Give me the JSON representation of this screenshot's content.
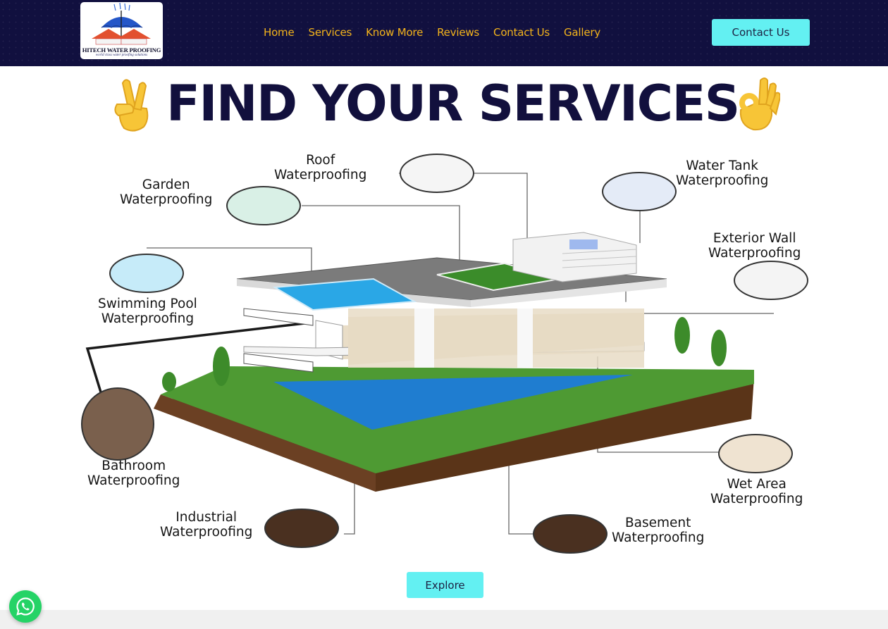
{
  "brand": {
    "name": "HITECH WATER PROOFING",
    "tagline": "world class water proofing solutions"
  },
  "nav": {
    "links": [
      "Home",
      "Services",
      "Know More",
      "Reviews",
      "Contact Us",
      "Gallery"
    ],
    "cta_label": "Contact Us"
  },
  "hero": {
    "headline": "FIND YOUR SERVICES",
    "emoji_left": "fingers-crossed-icon",
    "emoji_right": "ok-hand-icon"
  },
  "services_diagram": {
    "roof": [
      "Roof",
      "Waterproofing"
    ],
    "garden": [
      "Garden",
      "Waterproofing"
    ],
    "water_tank": [
      "Water Tank",
      "Waterproofing"
    ],
    "exterior_wall": [
      "Exterior Wall",
      "Waterproofing"
    ],
    "swimming_pool": [
      "Swimming Pool",
      "Waterproofing"
    ],
    "bathroom": [
      "Bathroom",
      "Waterproofing"
    ],
    "wet_area": [
      "Wet Area",
      "Waterproofing"
    ],
    "industrial": [
      "Industrial",
      "Waterproofing"
    ],
    "basement": [
      "Basement",
      "Waterproofing"
    ]
  },
  "explore_label": "Explore",
  "colors": {
    "navbar_bg": "#11103f",
    "nav_link": "#f3b31b",
    "button_bg": "#63f0f2",
    "headline": "#12103d",
    "whatsapp": "#25d366"
  }
}
